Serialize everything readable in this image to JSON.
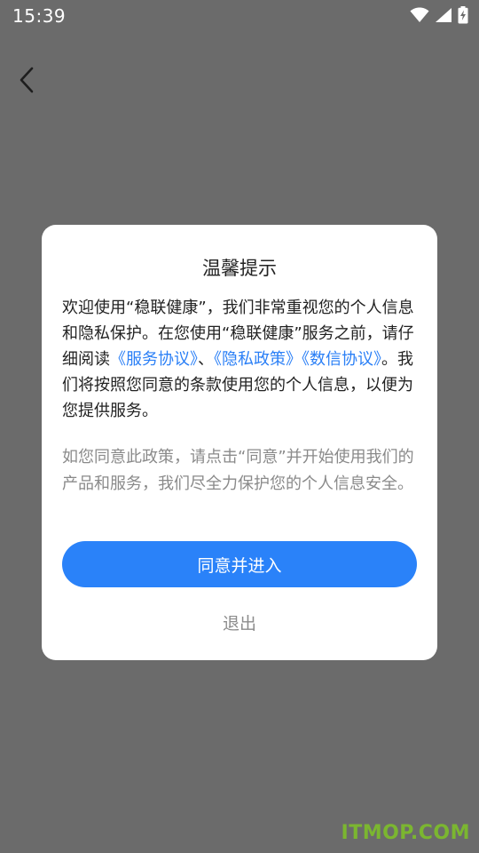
{
  "status_bar": {
    "time": "15:39",
    "icons": [
      "wifi-icon",
      "signal-icon",
      "battery-charging-icon"
    ]
  },
  "nav": {
    "back_icon": "chevron-left-icon"
  },
  "dialog": {
    "title": "温馨提示",
    "body": {
      "part1": "欢迎使用“稳联健康”，我们非常重视您的个人信息和隐私保护。在您使用“稳联健康”服务之前，请仔细阅读",
      "link_service": "《服务协议》",
      "sep": "、",
      "link_privacy": "《隐私政策》",
      "link_credit": "《数信协议》",
      "part2": "。我们将按照您同意的条款使用您的个人信息，以便为您提供服务。"
    },
    "note": "如您同意此政策，请点击“同意”并开始使用我们的产品和服务，我们尽全力保护您的个人信息安全。",
    "agree_label": "同意并进入",
    "exit_label": "退出"
  },
  "watermark": "ITMOP.COM",
  "colors": {
    "overlay": "#6b6b6b",
    "accent": "#2a82f9",
    "link": "#2a7ff6",
    "muted": "#8a8a8a"
  }
}
